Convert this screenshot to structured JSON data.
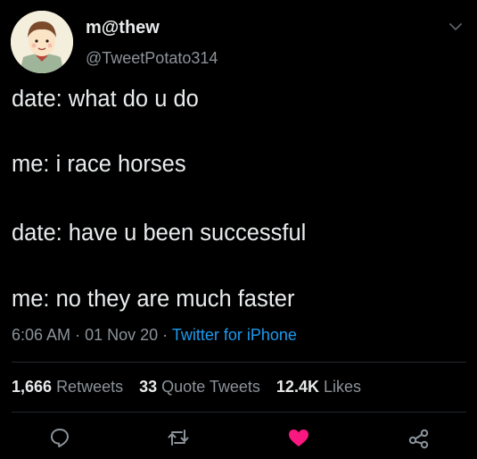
{
  "user": {
    "display_name": "m@thew",
    "handle": "@TweetPotato314"
  },
  "tweet": {
    "lines": [
      "date: what do u do",
      "me: i race horses",
      "date: have u been successful",
      "me: no they are much faster"
    ],
    "time": "6:06 AM",
    "separator": "·",
    "date": "01 Nov 20",
    "source": "Twitter for iPhone"
  },
  "stats": {
    "retweets_count": "1,666",
    "retweets_label": "Retweets",
    "quotes_count": "33",
    "quotes_label": "Quote Tweets",
    "likes_count": "12.4K",
    "likes_label": "Likes"
  },
  "icons": {
    "menu": "chevron-down-icon",
    "reply": "reply-icon",
    "retweet": "retweet-icon",
    "like": "heart-icon",
    "share": "share-icon"
  },
  "colors": {
    "background": "#000000",
    "text": "#e7e9ea",
    "secondary": "#8b9399",
    "link": "#1d9bf0",
    "like": "#f91880"
  }
}
